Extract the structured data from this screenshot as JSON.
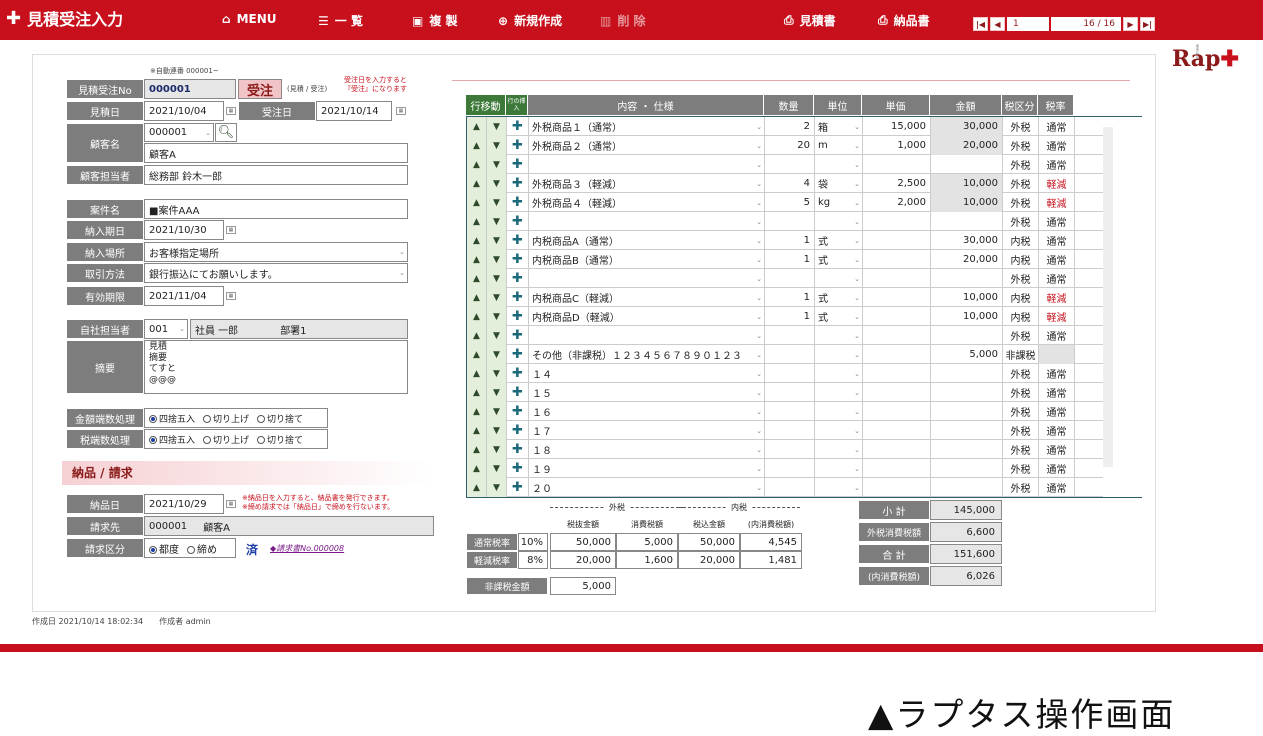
{
  "header": {
    "title": "見積受注入力",
    "menu": [
      {
        "icon": "home-icon",
        "label": "MENU"
      },
      {
        "icon": "list-icon",
        "label": "一 覧"
      },
      {
        "icon": "copy-icon",
        "label": "複 製"
      },
      {
        "icon": "plus-circle-icon",
        "label": "新規作成"
      },
      {
        "icon": "trash-icon",
        "label": "削 除"
      },
      {
        "icon": "printer-icon",
        "label": "見積書"
      },
      {
        "icon": "printer-icon",
        "label": "納品書"
      }
    ],
    "pager": {
      "current": "1",
      "count": "16 / 16"
    }
  },
  "logo": {
    "text": "Rap",
    "small": "販売管理"
  },
  "form": {
    "auto_note": "※自動連番 000001~",
    "order_no_label": "見積受注No",
    "order_no": "000001",
    "order_button": "受注",
    "order_hint": "(見積 / 受注)",
    "order_note1": "受注日を入力すると",
    "order_note2": "『受注』になります",
    "quote_date_label": "見積日",
    "quote_date": "2021/10/04",
    "order_date_label": "受注日",
    "order_date": "2021/10/14",
    "customer_label": "顧客名",
    "customer_code": "000001",
    "customer_name": "顧客A",
    "contact_label": "顧客担当者",
    "contact": "総務部 鈴木一郎",
    "project_label": "案件名",
    "project": "■案件AAA",
    "delivery_due_label": "納入期日",
    "delivery_due": "2021/10/30",
    "delivery_place_label": "納入場所",
    "delivery_place": "お客様指定場所",
    "payment_label": "取引方法",
    "payment": "銀行振込にてお願いします。",
    "valid_label": "有効期限",
    "valid": "2021/11/04",
    "staff_label": "自社担当者",
    "staff_code": "001",
    "staff_name": "社員 一郎",
    "staff_dept": "部署1",
    "memo_label": "摘要",
    "memo_lines": [
      "見積",
      "摘要",
      "てすと",
      "@@@"
    ],
    "rounding_label": "金額端数処理",
    "tax_rounding_label": "税端数処理",
    "opt_round": "四捨五入",
    "opt_up": "切り上げ",
    "opt_down": "切り捨て",
    "section_delivery": "納品 / 請求",
    "delivery_date_label": "納品日",
    "delivery_date": "2021/10/29",
    "delivery_note1": "※納品日を入力すると、納品書を発行できます。",
    "delivery_note2": "※締め請求では「納品日」で締めを行ないます。",
    "bill_to_label": "請求先",
    "bill_to_code": "000001",
    "bill_to_name": "顧客A",
    "bill_type_label": "請求区分",
    "opt_each": "都度",
    "opt_close": "締め",
    "done_mark": "済",
    "invoice_link": "◆請求書No.000008"
  },
  "grid": {
    "headers": [
      "行移動",
      "行の挿入",
      "内容 ・ 仕様",
      "数量",
      "単位",
      "単価",
      "金額",
      "税区分",
      "税率"
    ],
    "rows": [
      {
        "item": "外税商品１（通常）",
        "qty": "2",
        "unit": "箱",
        "price": "15,000",
        "amount": "30,000",
        "tax": "外税",
        "rate": "通常",
        "shade": true
      },
      {
        "item": "外税商品２（通常）",
        "qty": "20",
        "unit": "m",
        "price": "1,000",
        "amount": "20,000",
        "tax": "外税",
        "rate": "通常",
        "shade": true
      },
      {
        "item": "",
        "qty": "",
        "unit": "",
        "price": "",
        "amount": "",
        "tax": "外税",
        "rate": "通常",
        "shade": false
      },
      {
        "item": "外税商品３（軽減）",
        "qty": "4",
        "unit": "袋",
        "price": "2,500",
        "amount": "10,000",
        "tax": "外税",
        "rate": "軽減",
        "shade": true
      },
      {
        "item": "外税商品４（軽減）",
        "qty": "5",
        "unit": "kg",
        "price": "2,000",
        "amount": "10,000",
        "tax": "外税",
        "rate": "軽減",
        "shade": true
      },
      {
        "item": "",
        "qty": "",
        "unit": "",
        "price": "",
        "amount": "",
        "tax": "外税",
        "rate": "通常",
        "shade": false
      },
      {
        "item": "内税商品A（通常）",
        "qty": "1",
        "unit": "式",
        "price": "",
        "amount": "30,000",
        "tax": "内税",
        "rate": "通常",
        "shade": false
      },
      {
        "item": "内税商品B（通常）",
        "qty": "1",
        "unit": "式",
        "price": "",
        "amount": "20,000",
        "tax": "内税",
        "rate": "通常",
        "shade": false
      },
      {
        "item": "",
        "qty": "",
        "unit": "",
        "price": "",
        "amount": "",
        "tax": "外税",
        "rate": "通常",
        "shade": false
      },
      {
        "item": "内税商品C（軽減）",
        "qty": "1",
        "unit": "式",
        "price": "",
        "amount": "10,000",
        "tax": "内税",
        "rate": "軽減",
        "shade": false
      },
      {
        "item": "内税商品D（軽減）",
        "qty": "1",
        "unit": "式",
        "price": "",
        "amount": "10,000",
        "tax": "内税",
        "rate": "軽減",
        "shade": false
      },
      {
        "item": "",
        "qty": "",
        "unit": "",
        "price": "",
        "amount": "",
        "tax": "外税",
        "rate": "通常",
        "shade": false
      },
      {
        "item": "その他（非課税）１２３４５６７８９０１２３",
        "qty": "",
        "unit": "",
        "price": "",
        "amount": "5,000",
        "tax": "非課税",
        "rate": "",
        "shade": false
      },
      {
        "item": "１４",
        "qty": "",
        "unit": "",
        "price": "",
        "amount": "",
        "tax": "外税",
        "rate": "通常",
        "shade": false
      },
      {
        "item": "１５",
        "qty": "",
        "unit": "",
        "price": "",
        "amount": "",
        "tax": "外税",
        "rate": "通常",
        "shade": false
      },
      {
        "item": "１６",
        "qty": "",
        "unit": "",
        "price": "",
        "amount": "",
        "tax": "外税",
        "rate": "通常",
        "shade": false
      },
      {
        "item": "１７",
        "qty": "",
        "unit": "",
        "price": "",
        "amount": "",
        "tax": "外税",
        "rate": "通常",
        "shade": false
      },
      {
        "item": "１８",
        "qty": "",
        "unit": "",
        "price": "",
        "amount": "",
        "tax": "外税",
        "rate": "通常",
        "shade": false
      },
      {
        "item": "１９",
        "qty": "",
        "unit": "",
        "price": "",
        "amount": "",
        "tax": "外税",
        "rate": "通常",
        "shade": false
      },
      {
        "item": "２０",
        "qty": "",
        "unit": "",
        "price": "",
        "amount": "",
        "tax": "外税",
        "rate": "通常",
        "shade": false
      }
    ]
  },
  "tax_table": {
    "group_out": "外税",
    "group_in": "内税",
    "col_excl": "税抜金額",
    "col_tax": "消費税額",
    "col_incl": "税込金額",
    "col_inner": "(内消費税額)",
    "rows": [
      {
        "label": "通常税率",
        "rate": "10%",
        "excl": "50,000",
        "tax": "5,000",
        "incl": "50,000",
        "inner": "4,545"
      },
      {
        "label": "軽減税率",
        "rate": "8%",
        "excl": "20,000",
        "tax": "1,600",
        "incl": "20,000",
        "inner": "1,481"
      }
    ],
    "nontax_label": "非課税金額",
    "nontax": "5,000"
  },
  "summary": {
    "subtotal_label": "小 計",
    "subtotal": "145,000",
    "outer_tax_label": "外税消費税額",
    "outer_tax": "6,600",
    "total_label": "合 計",
    "total": "151,600",
    "inner_tax_label": "(内消費税額)",
    "inner_tax": "6,026"
  },
  "footer": {
    "created_label": "作成日",
    "created": "2021/10/14 18:02:34",
    "creator_label": "作成者",
    "creator": "admin"
  },
  "caption": "▲ラプタス操作画面",
  "colors": {
    "brand": "#c8101c",
    "label_gray": "#7d7d7d",
    "grid_border": "#2e5f6b"
  }
}
